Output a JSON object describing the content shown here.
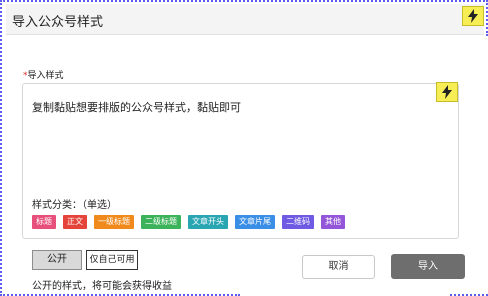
{
  "dialog": {
    "title": "导入公众号样式"
  },
  "form": {
    "label_required_mark": "*",
    "label": "导入样式",
    "placeholder": "复制黏贴想要排版的公众号样式，黏贴即可",
    "category_label": "样式分类：（单选）",
    "categories": [
      {
        "label": "标题",
        "color": "#e8507c"
      },
      {
        "label": "正文",
        "color": "#e4443a"
      },
      {
        "label": "一级标题",
        "color": "#f08a1d"
      },
      {
        "label": "二级标题",
        "color": "#3cb35a"
      },
      {
        "label": "文章开头",
        "color": "#2aa6b3"
      },
      {
        "label": "文章片尾",
        "color": "#3a8ee6"
      },
      {
        "label": "二维码",
        "color": "#6f5be3"
      },
      {
        "label": "其他",
        "color": "#9456d8"
      }
    ]
  },
  "visibility": {
    "public_label": "公开",
    "private_label": "仅自己可用",
    "note": "公开的样式，将可能会获得收益"
  },
  "actions": {
    "cancel_label": "取消",
    "import_label": "导入"
  },
  "icons": {
    "quick_action": "lightning-bolt-icon"
  },
  "colors": {
    "accent_badge": "#f7ed55",
    "required": "#e0302f",
    "primary_button": "#6e6e6e",
    "frame": "#5a5df0"
  }
}
